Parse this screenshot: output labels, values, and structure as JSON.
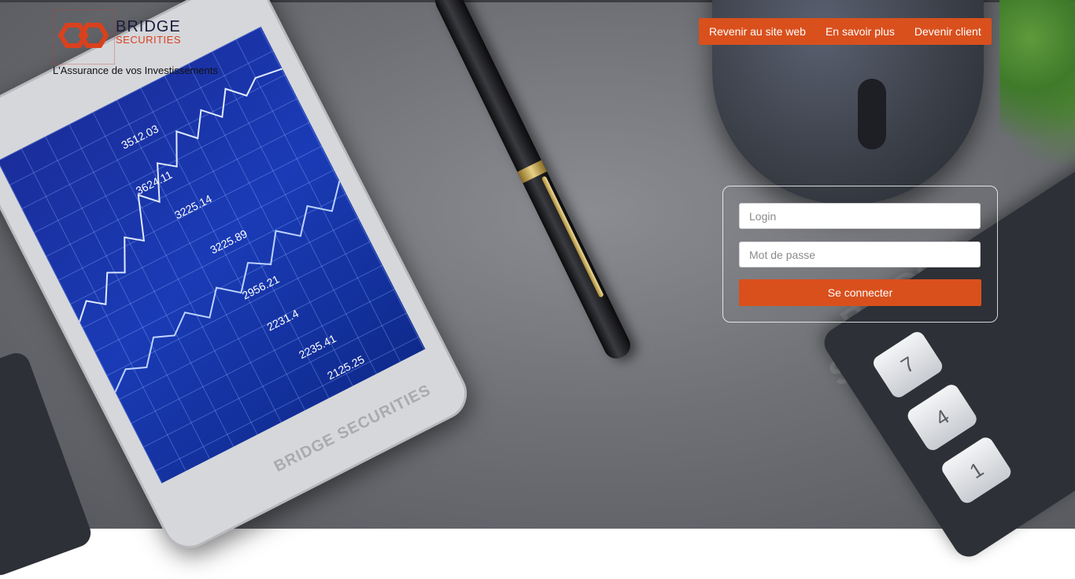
{
  "brand": {
    "title": "BRIDGE",
    "subtitle": "SECURITIES",
    "tagline": "L'Assurance de vos Investissements"
  },
  "nav": {
    "items": [
      {
        "label": "Revenir au site web"
      },
      {
        "label": "En savoir plus"
      },
      {
        "label": "Devenir client"
      }
    ]
  },
  "login_form": {
    "login_placeholder": "Login",
    "password_placeholder": "Mot de passe",
    "submit_label": "Se connecter"
  },
  "background": {
    "phone_chart_labels": [
      "3512.03",
      "3624.11",
      "3225.14",
      "3225.89",
      "2956.21",
      "2231.4",
      "2235.41",
      "2125.25"
    ],
    "watermark_text": "BRIDGE SECURITIES",
    "calculator_keys": [
      "7",
      "4",
      "1"
    ]
  },
  "colors": {
    "accent": "#d9501d",
    "logo_dark": "#1b1b3a"
  }
}
